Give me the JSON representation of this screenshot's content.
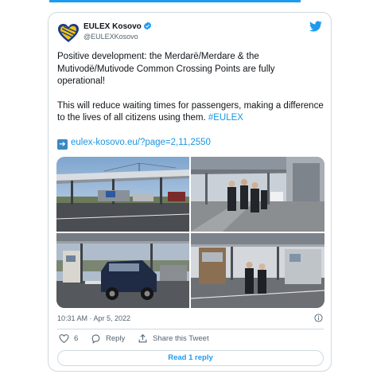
{
  "author": {
    "name": "EULEX Kosovo",
    "handle": "@EULEXKosovo",
    "avatar_icon": "eulex-heart-logo-icon",
    "verified_icon": "verified-badge-icon"
  },
  "tweet": {
    "paragraph1": "Positive development: the Merdarë/Merdare & the Mutivodë/Mutivode Common Crossing Points are fully operational!",
    "paragraph2_text": "This will reduce waiting times for passengers, making a difference to the lives of all citizens using them. ",
    "hashtag": "#EULEX",
    "link_icon": "right-arrow-icon",
    "link_text": "eulex-kosovo.eu/?page=2,11,2550",
    "timestamp": "10:31 AM · Apr 5, 2022"
  },
  "actions": {
    "like_count": "6",
    "reply_label": "Reply",
    "share_label": "Share this Tweet",
    "read_reply_label": "Read 1 reply"
  },
  "colors": {
    "accent": "#1d9bf0",
    "link": "#1b95e0",
    "muted_text": "#536471",
    "border": "#cfd9de"
  }
}
